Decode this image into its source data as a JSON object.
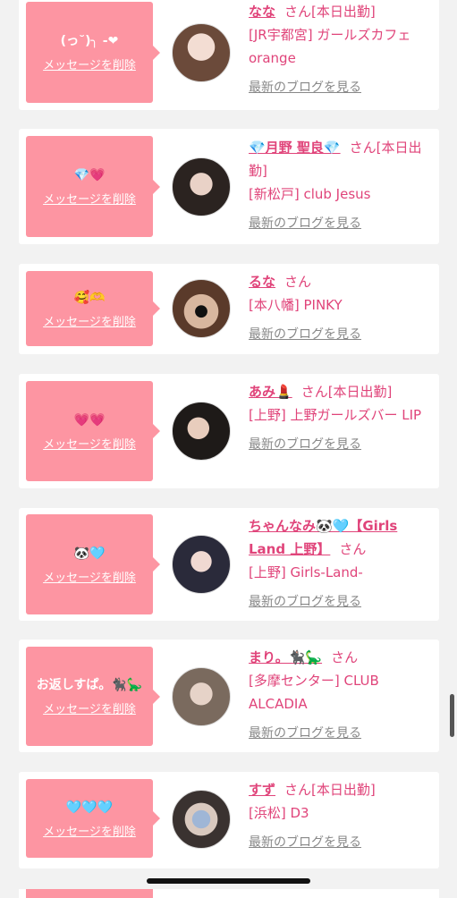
{
  "delete_label": "メッセージを削除",
  "blog_label": "最新のブログを見る",
  "san_label": "さん",
  "accent_color": "#fd95a2",
  "text_color": "#e0447a",
  "cards": [
    {
      "message": "(っ˘)╮ -❤",
      "name": "なな",
      "status": "[本日出勤]",
      "shop": "[JR宇都宮] ガールズカフェ orange"
    },
    {
      "message": "💎💗",
      "name": "💎月野 聖良💎",
      "status": "[本日出勤]",
      "shop": "[新松戸] club Jesus"
    },
    {
      "message": "🥰🫶",
      "name": "るな",
      "status": "",
      "shop": "[本八幡] PINKY"
    },
    {
      "message": "💗💗",
      "name": "あみ💄",
      "status": "[本日出勤]",
      "shop": "[上野] 上野ガールズバー LIP"
    },
    {
      "message": "🐼🩵",
      "name": "ちゃんなみ🐼🩵【Girls Land 上野】",
      "status": "",
      "shop": "[上野] Girls-Land-"
    },
    {
      "message": "お返しすぱ。🐈‍⬛🦕",
      "name": "まり。🐈‍⬛🦕",
      "status": "",
      "shop": "[多摩センター] CLUB ALCADIA"
    },
    {
      "message": "🩵🩵🩵",
      "name": "すず",
      "status": "[本日出勤]",
      "shop": "[浜松] D3"
    }
  ]
}
